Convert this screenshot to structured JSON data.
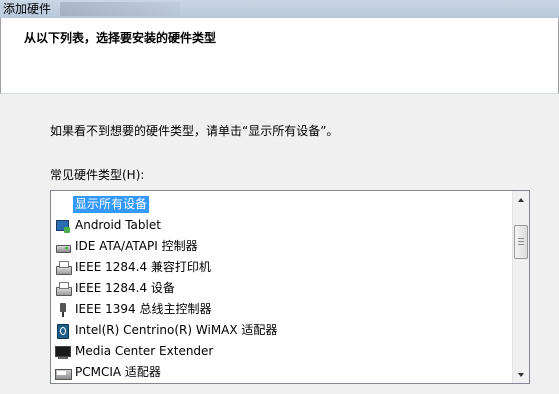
{
  "window": {
    "title": "添加硬件"
  },
  "header": {
    "heading": "从以下列表，选择要安装的硬件类型"
  },
  "content": {
    "hint": "如果看不到想要的硬件类型，请单击“显示所有设备”。",
    "list_label": "常见硬件类型(H):"
  },
  "list": {
    "items": [
      {
        "label": "显示所有设备",
        "icon": "none",
        "selected": true
      },
      {
        "label": "Android Tablet",
        "icon": "tablet-icon"
      },
      {
        "label": "IDE ATA/ATAPI 控制器",
        "icon": "disk-controller-icon"
      },
      {
        "label": "IEEE 1284.4 兼容打印机",
        "icon": "printer-icon"
      },
      {
        "label": "IEEE 1284.4 设备",
        "icon": "printer-icon"
      },
      {
        "label": "IEEE 1394 总线主控制器",
        "icon": "firewire-icon"
      },
      {
        "label": "Intel(R) Centrino(R) WiMAX 适配器",
        "icon": "wimax-adapter-icon"
      },
      {
        "label": "Media Center Extender",
        "icon": "media-center-icon"
      },
      {
        "label": "PCMCIA 适配器",
        "icon": "pcmcia-icon"
      }
    ]
  },
  "colors": {
    "selection": "#3399ff",
    "title_bar": "#b9c8dc"
  }
}
